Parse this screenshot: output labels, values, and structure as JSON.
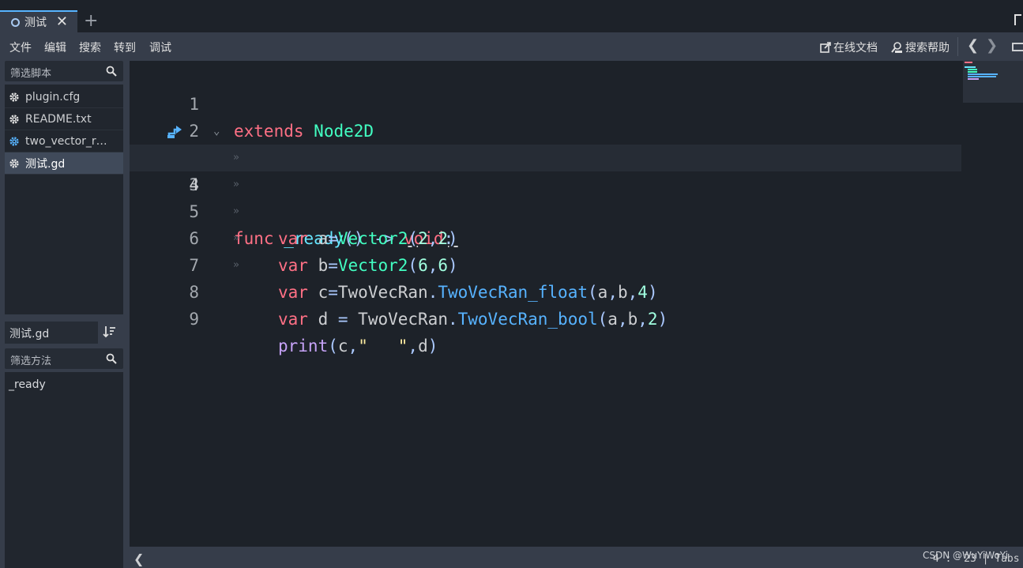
{
  "tabs": [
    {
      "label": "测试",
      "close": "✕"
    }
  ],
  "add_tab": "+",
  "menu": {
    "items": [
      "文件",
      "编辑",
      "搜索",
      "转到",
      "调试"
    ],
    "online_docs": "在线文档",
    "search_help": "搜索帮助",
    "back": "❮",
    "forward": "❯"
  },
  "left_panel": {
    "script_filter_placeholder": "筛选脚本",
    "scripts": [
      {
        "label": "plugin.cfg",
        "icon": "gear-icon",
        "icon_color": "#e0e0e0",
        "selected": false
      },
      {
        "label": "README.txt",
        "icon": "gear-icon",
        "icon_color": "#e0e0e0",
        "selected": false
      },
      {
        "label": "two_vector_ran...",
        "icon": "gear-icon",
        "icon_color": "#57b3ff",
        "selected": false
      },
      {
        "label": "测试.gd",
        "icon": "gear-icon",
        "icon_color": "#e0e0e0",
        "selected": true
      }
    ],
    "current_file": "测试.gd",
    "method_filter_placeholder": "筛选方法",
    "methods": [
      "_ready"
    ]
  },
  "editor": {
    "current_line": 4,
    "line_numbers": [
      "1",
      "2",
      "3",
      "4",
      "5",
      "6",
      "7",
      "8",
      "9"
    ],
    "lines": {
      "l1": [
        "extends",
        " ",
        "Node2D"
      ],
      "l3": [
        "func",
        " ",
        "_ready",
        "()",
        " ",
        "->",
        " ",
        "void",
        ":"
      ],
      "l4": [
        "var",
        " a",
        "=",
        "Vector2",
        "(",
        "2",
        ",",
        "2",
        ")"
      ],
      "l5": [
        "var",
        " b",
        "=",
        "Vector2",
        "(",
        "6",
        ",",
        "6",
        ")"
      ],
      "l6": [
        "var",
        " c",
        "=",
        "TwoVecRan",
        ".",
        "TwoVecRan_float",
        "(",
        "a",
        ",",
        "b",
        ",",
        "4",
        ")"
      ],
      "l7": [
        "var",
        " d ",
        "=",
        " TwoVecRan",
        ".",
        "TwoVecRan_bool",
        "(",
        "a",
        ",",
        "b",
        ",",
        "2",
        ")"
      ],
      "l8": [
        "print",
        "(",
        "c",
        ",",
        "\"   \"",
        ",",
        "d",
        ")"
      ]
    },
    "tab_marker": "»"
  },
  "status": {
    "left_arrow": "❮",
    "position": "4 :  23 | Tabs"
  },
  "watermark": "CSDN @WuYiWoYi"
}
